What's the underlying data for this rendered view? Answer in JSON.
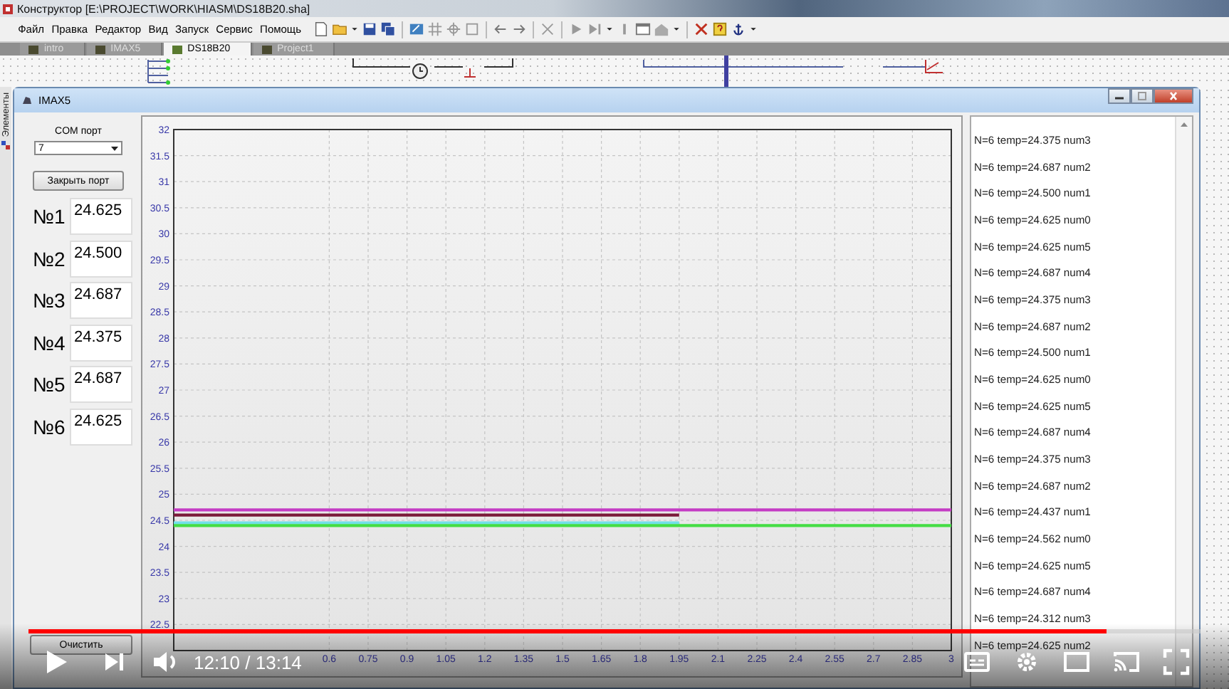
{
  "app_window": {
    "title": "Конструктор [E:\\PROJECT\\WORK\\HIASM\\DS18B20.sha]"
  },
  "menu": [
    "Файл",
    "Правка",
    "Редактор",
    "Вид",
    "Запуск",
    "Сервис",
    "Помощь"
  ],
  "tabs": [
    {
      "label": "intro",
      "selected": false
    },
    {
      "label": "IMAX5",
      "selected": false
    },
    {
      "label": "DS18B20",
      "selected": true
    },
    {
      "label": "Project1",
      "selected": false
    }
  ],
  "side_tab": {
    "label": "Элементы"
  },
  "form": {
    "title": "IMAX5",
    "com_port": {
      "label": "COM порт",
      "value": "7"
    },
    "close_port_button": "Закрыть порт",
    "sensors": [
      {
        "label": "№1",
        "value": "24.625"
      },
      {
        "label": "№2",
        "value": "24.500"
      },
      {
        "label": "№3",
        "value": "24.687"
      },
      {
        "label": "№4",
        "value": "24.375"
      },
      {
        "label": "№5",
        "value": "24.687"
      },
      {
        "label": "№6",
        "value": "24.625"
      }
    ],
    "clear_button": "Очистить",
    "chart_data": {
      "type": "line",
      "x": [
        0,
        1.95,
        3
      ],
      "series": [
        {
          "color": "#c43cc4",
          "values": [
            24.7,
            24.7,
            24.7
          ]
        },
        {
          "color": "#7a1a3a",
          "values": [
            24.6,
            24.6,
            null
          ]
        },
        {
          "color": "#70e0e8",
          "values": [
            24.45,
            24.45,
            null
          ]
        },
        {
          "color": "#44dd44",
          "values": [
            24.4,
            24.4,
            24.4
          ]
        }
      ],
      "xlim": [
        0,
        3
      ],
      "ylim": [
        22,
        32
      ],
      "grid": true,
      "xticks": [
        0.6,
        0.75,
        0.9,
        1.05,
        1.2,
        1.35,
        1.5,
        1.65,
        1.8,
        1.95,
        2.1,
        2.25,
        2.4,
        2.55,
        2.7,
        2.85,
        3
      ],
      "yticks": [
        22.5,
        23,
        23.5,
        24,
        24.5,
        25,
        25.5,
        26,
        26.5,
        27,
        27.5,
        28,
        28.5,
        29,
        29.5,
        30,
        30.5,
        31,
        31.5,
        32
      ]
    },
    "log": [
      "N=6 temp=24.375 num3",
      "N=6 temp=24.687 num2",
      "N=6 temp=24.500 num1",
      "N=6 temp=24.625 num0",
      "N=6 temp=24.625 num5",
      "N=6 temp=24.687 num4",
      "N=6 temp=24.375 num3",
      "N=6 temp=24.687 num2",
      "N=6 temp=24.500 num1",
      "N=6 temp=24.625 num0",
      "N=6 temp=24.625 num5",
      "N=6 temp=24.687 num4",
      "N=6 temp=24.375 num3",
      "N=6 temp=24.687 num2",
      "N=6 temp=24.437 num1",
      "N=6 temp=24.562 num0",
      "N=6 temp=24.625 num5",
      "N=6 temp=24.687 num4",
      "N=6 temp=24.312 num3",
      "N=6 temp=24.625 num2"
    ]
  },
  "video_player": {
    "progress": {
      "level": 0.92
    },
    "time": "12:10 / 13:14"
  }
}
